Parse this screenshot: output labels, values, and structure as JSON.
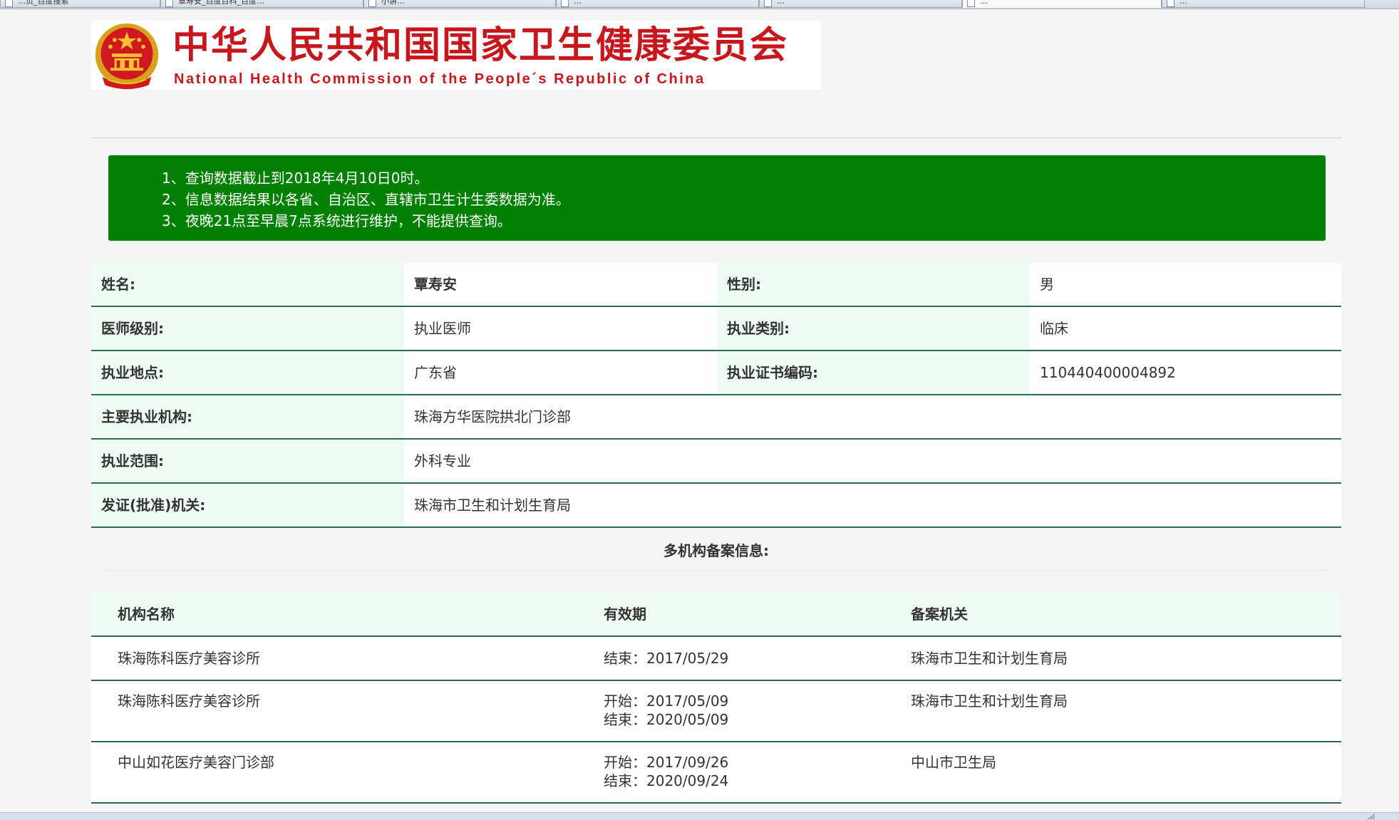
{
  "browser": {
    "tabs": [
      {
        "label": "…页_百度搜索"
      },
      {
        "label": "覃寿安_百度百科_百度…"
      },
      {
        "label": "小讲…"
      },
      {
        "label": "…"
      },
      {
        "label": "…"
      },
      {
        "label": "…",
        "active": true
      },
      {
        "label": "…"
      }
    ]
  },
  "header": {
    "title_cn": "中华人民共和国国家卫生健康委员会",
    "title_en": "National Health Commission of the People´s Republic of China"
  },
  "notice": {
    "lines": [
      "1、查询数据截止到2018年4月10日0时。",
      "2、信息数据结果以各省、自治区、直辖市卫生计生委数据为准。",
      "3、夜晚21点至早晨7点系统进行维护，不能提供查询。"
    ]
  },
  "doctor": {
    "name_label": "姓名:",
    "name": "覃寿安",
    "gender_label": "性别:",
    "gender": "男",
    "level_label": "医师级别:",
    "level": "执业医师",
    "category_label": "执业类别:",
    "category": "临床",
    "location_label": "执业地点:",
    "location": "广东省",
    "cert_label": "执业证书编码:",
    "cert": "110440400004892",
    "institution_label": "主要执业机构:",
    "institution": "珠海方华医院拱北门诊部",
    "scope_label": "执业范围:",
    "scope": "外科专业",
    "authority_label": "发证(批准)机关:",
    "authority": "珠海市卫生和计划生育局"
  },
  "multi": {
    "title": "多机构备案信息:",
    "headers": {
      "name": "机构名称",
      "validity": "有效期",
      "authority": "备案机关"
    },
    "rows": [
      {
        "name": "珠海陈科医疗美容诊所",
        "start": "",
        "end": "结束：2017/05/29",
        "authority": "珠海市卫生和计划生育局"
      },
      {
        "name": "珠海陈科医疗美容诊所",
        "start": "开始：2017/05/09",
        "end": "结束：2020/05/09",
        "authority": "珠海市卫生和计划生育局"
      },
      {
        "name": "中山如花医疗美容门诊部",
        "start": "开始：2017/09/26",
        "end": "结束：2020/09/24",
        "authority": "中山市卫生局"
      }
    ]
  },
  "colors": {
    "brand_red": "#c8161d",
    "notice_green": "#008000",
    "label_bg": "#eefbf3",
    "row_border": "#2d6a4f"
  }
}
